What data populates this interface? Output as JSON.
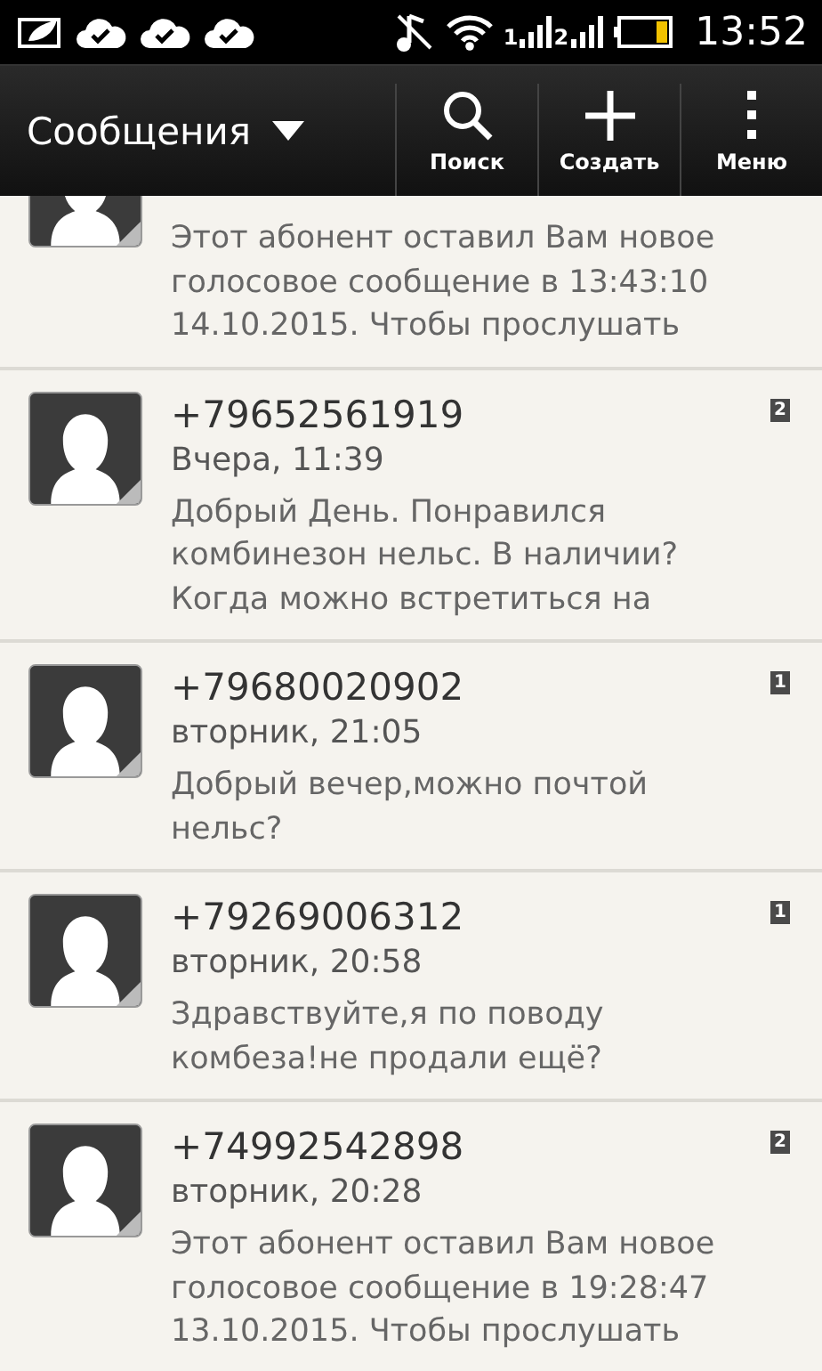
{
  "status_bar": {
    "sims": [
      "1",
      "2"
    ],
    "time": "13:52"
  },
  "header": {
    "title": "Сообщения",
    "actions": [
      {
        "kind": "search",
        "label": "Поиск"
      },
      {
        "kind": "create",
        "label": "Создать"
      },
      {
        "kind": "menu",
        "label": "Меню"
      }
    ]
  },
  "messages": [
    {
      "kind": "cut",
      "preview": "Этот абонент оставил Вам новое голосовое сообщение в 13:43:10 14.10.2015. Чтобы прослушать"
    },
    {
      "kind": "full",
      "sender": "+79652561919",
      "date": "Вчера, 11:39",
      "preview": "Добрый День. Понравился комбинезон нельс. В наличии? Когда можно встретиться на",
      "badge": "2"
    },
    {
      "kind": "full",
      "sender": "+79680020902",
      "date": "вторник, 21:05",
      "preview": "Добрый вечер,можно почтой нельс?",
      "badge": "1"
    },
    {
      "kind": "full",
      "sender": "+79269006312",
      "date": "вторник, 20:58",
      "preview": "Здравствуйте,я по поводу комбеза!не продали ещё?",
      "badge": "1"
    },
    {
      "kind": "full",
      "sender": "+74992542898",
      "date": "вторник, 20:28",
      "preview": "Этот абонент оставил Вам новое голосовое сообщение в 19:28:47 13.10.2015. Чтобы прослушать",
      "badge": "2"
    }
  ]
}
